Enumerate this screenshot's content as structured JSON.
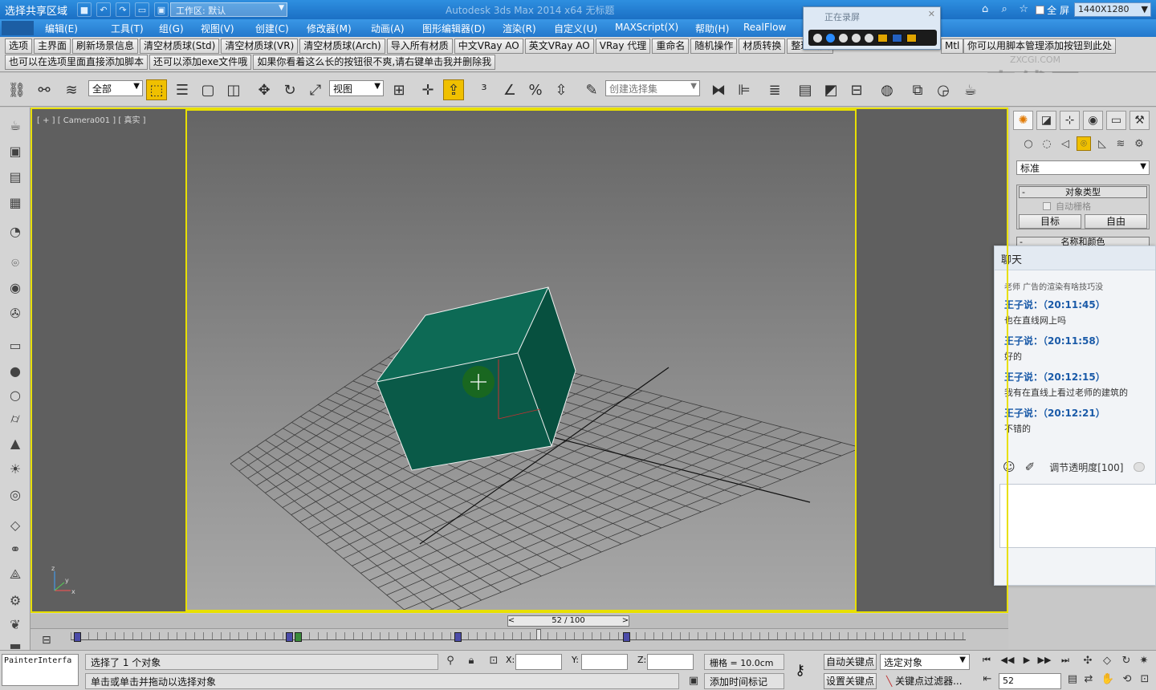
{
  "titlebar": {
    "share_label": "选择共享区域",
    "workspace": "工作区: 默认",
    "app_title": "Autodesk 3ds Max  2014 x64    无标题",
    "fullscreen_label": "全 屏",
    "resolution": "1440X1280"
  },
  "menu": [
    "编辑(E)",
    "工具(T)",
    "组(G)",
    "视图(V)",
    "创建(C)",
    "修改器(M)",
    "动画(A)",
    "图形编辑器(D)",
    "渲染(R)",
    "自定义(U)",
    "MAXScript(X)",
    "帮助(H)",
    "RealFlow"
  ],
  "script_row1": [
    "选项",
    "主界面",
    "刷新场景信息",
    "清空材质球(Std)",
    "清空材质球(VR)",
    "清空材质球(Arch)",
    "导入所有材质",
    "中文VRay AO",
    "英文VRay AO",
    "VRay 代理",
    "重命名",
    "随机操作",
    "材质转换",
    "整理丢失"
  ],
  "script_row1_right": "你可以用脚本管理添加按钮到此处",
  "script_row1_right_prefix": "Mtl",
  "script_row2": [
    "也可以在选项里面直接添加脚本",
    "还可以添加exe文件哦",
    "如果你看着这么长的按钮很不爽,请右键单击我并删除我"
  ],
  "recorder": {
    "title": "正在录屏"
  },
  "watermark": {
    "big": "直线网",
    "small": "ZXCGI.COM"
  },
  "toolbar": {
    "filter_select": "全部",
    "refcoord_select": "视图",
    "selection_set_placeholder": "创建选择集"
  },
  "viewport": {
    "label": "[ + ] [ Camera001 ] [ 真实 ]",
    "box_color": "#0a5a48",
    "highlight_color": "#e8e000"
  },
  "command_panel": {
    "category": "标准",
    "rollout_object_type": "对象类型",
    "auto_grid": "自动栅格",
    "btn_target": "目标",
    "btn_free": "自由",
    "rollout_name_color": "名称和颜色"
  },
  "chat": {
    "title": "聊天",
    "preview": "老师 广告的渲染有啥技巧没",
    "messages": [
      {
        "sender": "王子说：（20:11:45）",
        "text": "也在直线网上吗"
      },
      {
        "sender": "王子说：（20:11:58）",
        "text": "好的"
      },
      {
        "sender": "王子说：（20:12:15）",
        "text": "我有在直线上看过老师的建筑的"
      },
      {
        "sender": "王子说：（20:12:21）",
        "text": "不错的"
      }
    ],
    "opacity_label": "调节透明度[100]"
  },
  "timeline": {
    "frame": "52 / 100",
    "prev": "<",
    "next": ">"
  },
  "status": {
    "painter": "PainterInterfa",
    "line1": "选择了 1 个对象",
    "line2": "单击或单击并拖动以选择对象",
    "x_label": "X:",
    "y_label": "Y:",
    "z_label": "Z:",
    "grid": "栅格 = 10.0cm",
    "add_time_tag": "添加时间标记",
    "auto_key": "自动关键点",
    "set_key": "设置关键点",
    "key_mode": "选定对象",
    "key_filter": "关键点过滤器...",
    "current_frame": "52"
  }
}
